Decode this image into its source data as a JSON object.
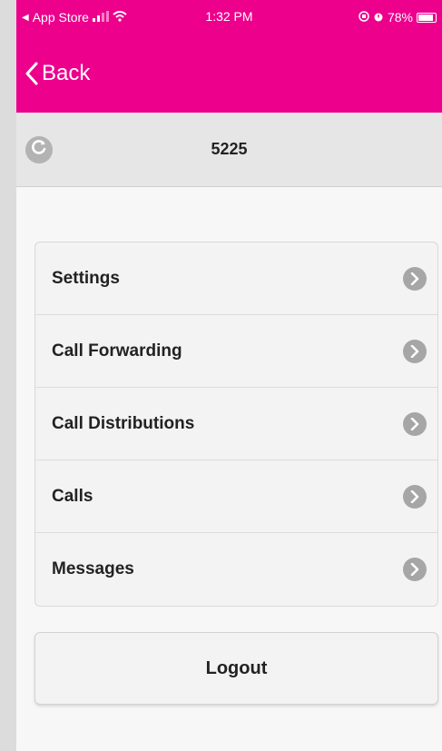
{
  "status_bar": {
    "back_app": "App Store",
    "time": "1:32 PM",
    "battery_percent": "78%"
  },
  "nav": {
    "back_label": "Back"
  },
  "header": {
    "title": "5225"
  },
  "menu": {
    "items": [
      {
        "label": "Settings"
      },
      {
        "label": "Call Forwarding"
      },
      {
        "label": "Call Distributions"
      },
      {
        "label": "Calls"
      },
      {
        "label": "Messages"
      }
    ]
  },
  "logout_label": "Logout",
  "colors": {
    "accent": "#ec008c",
    "header_bg": "#e6e6e6",
    "chevron": "#a6a6a6"
  },
  "icons": [
    "back-triangle-icon",
    "signal-icon",
    "wifi-icon",
    "orientation-lock-icon",
    "alarm-icon",
    "battery-icon",
    "chevron-left-icon",
    "refresh-icon",
    "chevron-right-icon"
  ]
}
